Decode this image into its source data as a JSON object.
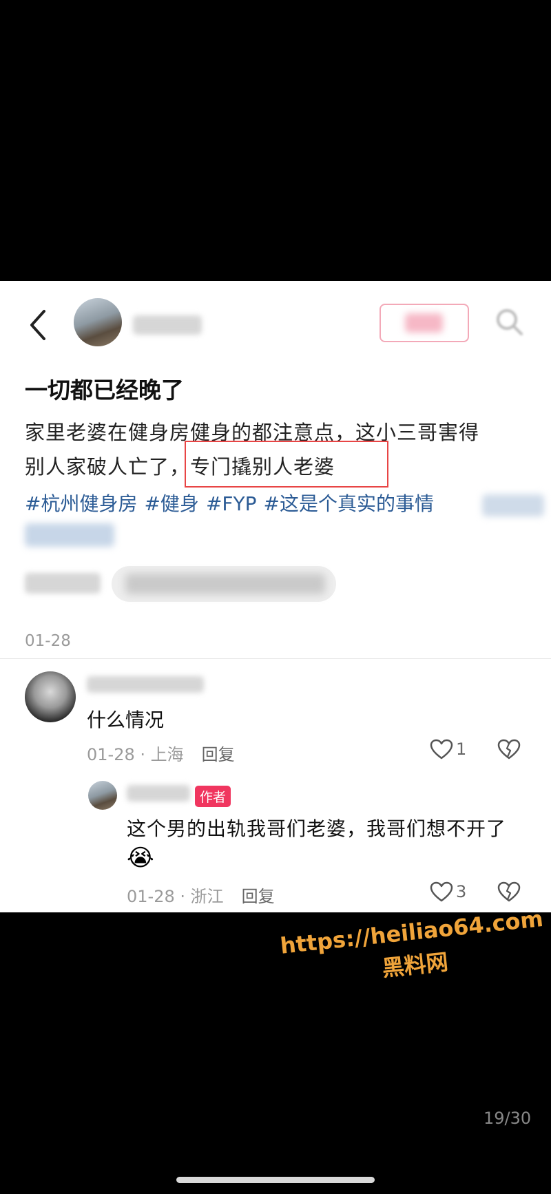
{
  "post": {
    "title": "一切都已经晚了",
    "body_line1": "家里老婆在健身房健身的都注意点，这小三哥害得",
    "body_line2_prefix": "别人家破人亡了，",
    "body_line2_highlight": "专门撬别人老婆",
    "tags": [
      "#杭州健身房",
      "#健身",
      "#FYP",
      "#这是个真实的事情"
    ],
    "date": "01-28"
  },
  "comments": [
    {
      "text": "什么情况",
      "date": "01-28",
      "location": "上海",
      "reply_label": "回复",
      "likes": "1"
    },
    {
      "author_badge": "作者",
      "text": "这个男的出轨我哥们老婆，我哥们想不开了",
      "emoji": "😭",
      "date": "01-28",
      "location": "浙江",
      "reply_label": "回复",
      "likes": "3"
    }
  ],
  "watermark": {
    "url": "https://heiliao64.com",
    "name": "黑料网"
  },
  "pager": "19/30",
  "colors": {
    "highlight_border": "#e84545",
    "tag_blue": "#2b5b95",
    "author_badge": "#f0365f",
    "watermark": "#f0a43a"
  },
  "icons": {
    "back": "chevron-left-icon",
    "search": "search-icon",
    "like": "heart-icon",
    "dislike": "broken-heart-icon"
  }
}
